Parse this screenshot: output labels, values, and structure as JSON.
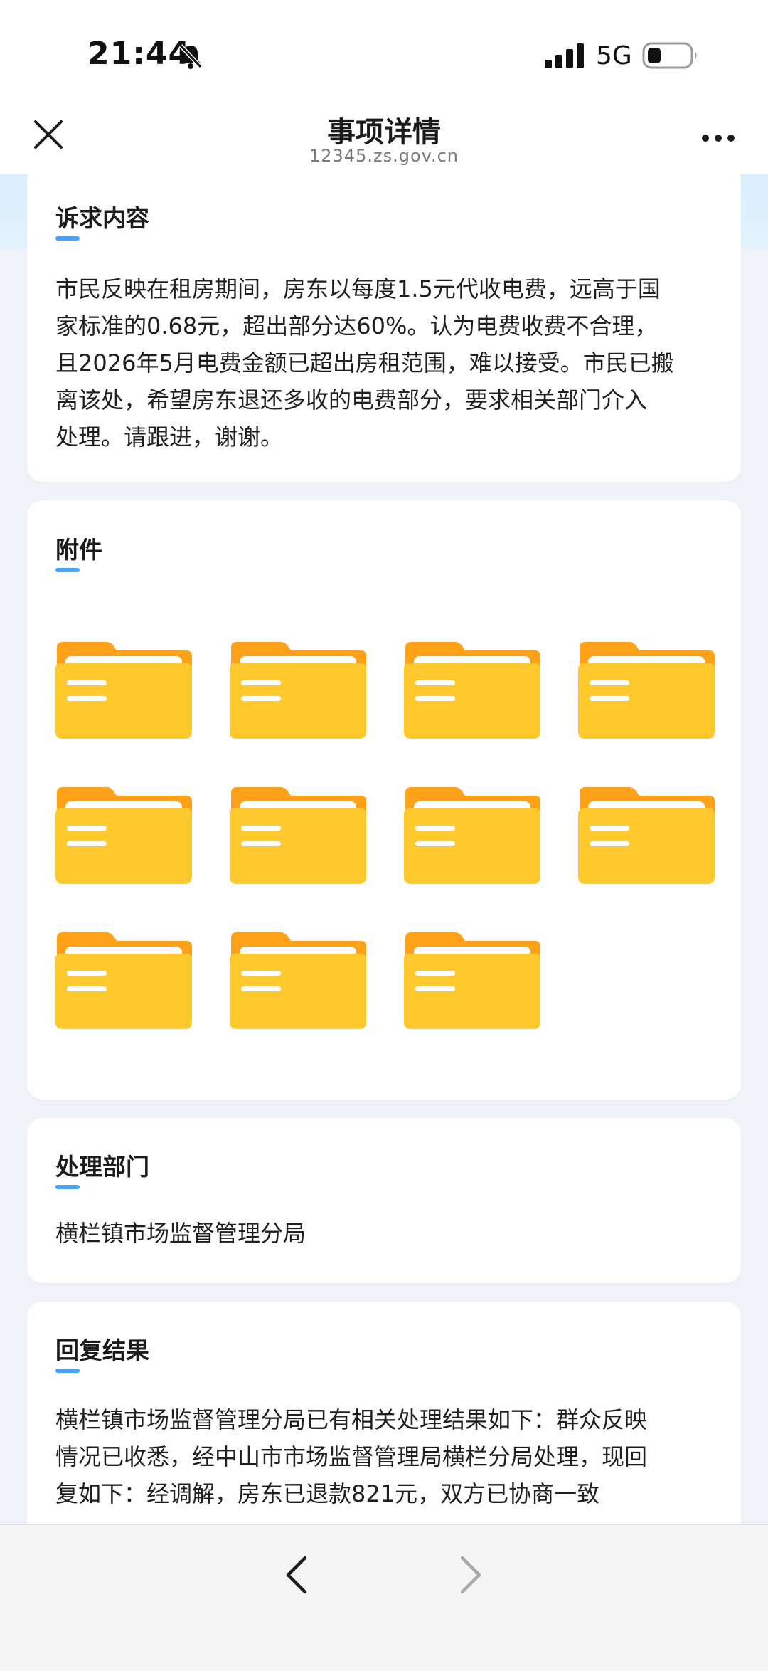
{
  "status_bar": {
    "time": "21:44",
    "network": "5G"
  },
  "nav": {
    "title": "事项详情",
    "subtitle": "12345.zs.gov.cn"
  },
  "appeal": {
    "title": "诉求内容",
    "lines": [
      "市民反映在租房期间，房东以每度1.5元代收电费，远高于国",
      "家标准的0.68元，超出部分达60%。认为电费收费不合理，",
      "且2026年5月电费金额已超出房租范围，难以接受。市民已搬",
      "离该处，希望房东退还多收的电费部分，要求相关部门介入",
      "处理。请跟进，谢谢。"
    ]
  },
  "attachments": {
    "title": "附件",
    "count": 11,
    "icon": "folder-icon"
  },
  "department": {
    "title": "处理部门",
    "name": "横栏镇市场监督管理分局"
  },
  "reply": {
    "title": "回复结果",
    "lines": [
      "横栏镇市场监督管理分局已有相关处理结果如下：群众反映",
      "情况已收悉，经中山市市场监督管理局横栏分局处理，现回",
      "复如下：经调解，房东已退款821元，双方已协商一致"
    ]
  },
  "bottom_nav": {
    "back_icon": "chevron-left-icon",
    "forward_icon": "chevron-right-icon"
  },
  "colors": {
    "accent": "#4aa3f5",
    "folder_back": "#ffa21a",
    "folder_front": "#ffc92e",
    "background": "#f0f3f7"
  }
}
